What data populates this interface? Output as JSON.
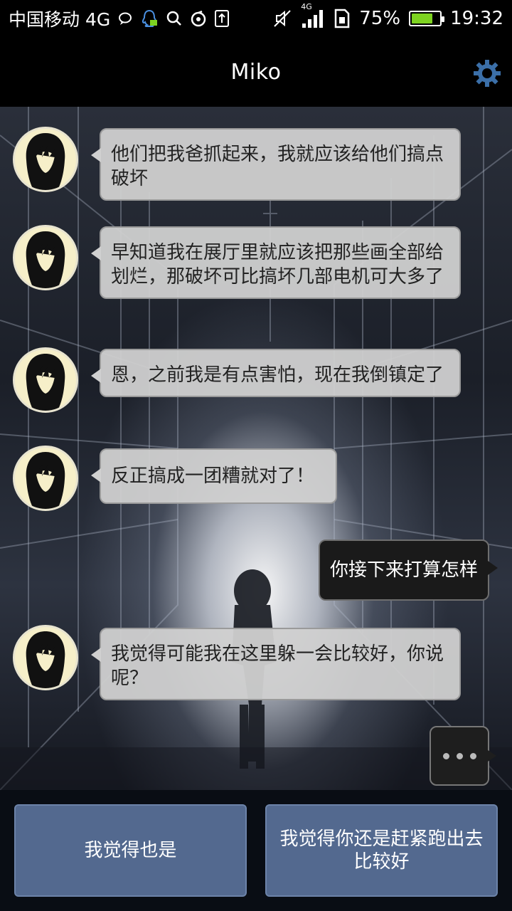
{
  "status_bar": {
    "carrier": "中国移动 4G",
    "network": "4G",
    "battery_percent": "75%",
    "battery_level": 0.75,
    "time": "19:32",
    "left_icons": [
      "chat-bubble-icon",
      "qq-penguin-icon",
      "search-icon",
      "music-icon",
      "upload-icon"
    ],
    "right_icons": [
      "mute-icon",
      "signal-icon",
      "sim-icon",
      "battery-icon"
    ]
  },
  "header": {
    "title": "Miko",
    "settings_icon": "gear-icon"
  },
  "messages": [
    {
      "from": "Miko",
      "text": "他们把我爸抓起来，我就应该给他们搞点破坏"
    },
    {
      "from": "Miko",
      "text": "早知道我在展厅里就应该把那些画全部给划烂，那破坏可比搞坏几部电机可大多了"
    },
    {
      "from": "Miko",
      "text": "恩，之前我是有点害怕，现在我倒镇定了"
    },
    {
      "from": "Miko",
      "text": "反正搞成一团糟就对了！"
    },
    {
      "from": "me",
      "text": "你接下来打算怎样"
    },
    {
      "from": "Miko",
      "text": "我觉得可能我在这里躲一会比较好，你说呢？"
    }
  ],
  "choices": [
    {
      "label": "我觉得也是"
    },
    {
      "label": "我觉得你还是赶紧跑出去比较好"
    }
  ],
  "colors": {
    "choice_bg": "#53698f",
    "incoming_bubble": "#d0d0d0",
    "outgoing_bubble": "#1a1a1a",
    "gear": "#3b6fa8",
    "battery_fill": "#7ed321"
  }
}
